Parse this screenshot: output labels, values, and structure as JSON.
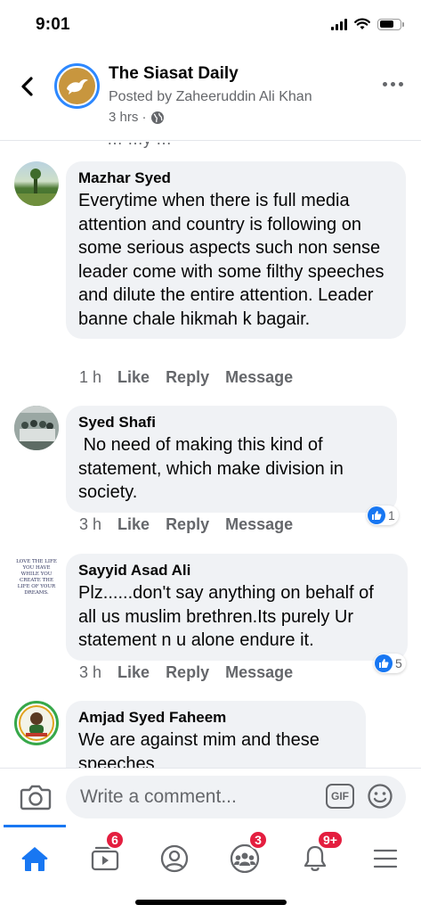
{
  "status_bar": {
    "time": "9:01"
  },
  "header": {
    "title": "The Siasat Daily",
    "posted_by": "Posted by Zaheeruddin Ali Khan",
    "time": "3 hrs ·"
  },
  "cut_text": "… …y …",
  "comments": [
    {
      "name": "Mazhar Syed",
      "text": "Everytime when there is full media attention and country is following on some serious aspects such non sense leader come with some filthy speeches and dilute the entire attention. Leader banne chale hikmah k bagair.",
      "time": "1 h",
      "like": "Like",
      "reply": "Reply",
      "message": "Message"
    },
    {
      "name": "Syed Shafi",
      "text": " No need of making this kind of statement, which make division in society.",
      "time": "3 h",
      "like": "Like",
      "reply": "Reply",
      "message": "Message",
      "reactions": "1"
    },
    {
      "name": "Sayyid Asad Ali",
      "avatar_text": "LOVE THE LIFE YOU HAVE WHILE YOU CREATE THE LIFE OF YOUR DREAMS.",
      "text": "Plz......don't say anything on behalf of all us muslim brethren.Its purely Ur statement n u alone endure it.",
      "time": "3 h",
      "like": "Like",
      "reply": "Reply",
      "message": "Message",
      "reactions": "5"
    },
    {
      "name": "Amjad Syed Faheem",
      "text": "We are against mim and these speeches"
    }
  ],
  "comment_bar": {
    "placeholder": "Write a comment...",
    "gif_label": "GIF"
  },
  "tabs": {
    "watch_badge": "6",
    "groups_badge": "3",
    "notifications_badge": "9+"
  },
  "colors": {
    "accent": "#1877f2",
    "badge": "#e41e3f",
    "bubble": "#f0f2f5",
    "secondary_text": "#65676b"
  },
  "icons": [
    "back-icon",
    "more-icon",
    "globe-icon",
    "like-icon",
    "camera-icon",
    "emoji-icon",
    "home-icon",
    "watch-icon",
    "profile-icon",
    "groups-icon",
    "bell-icon",
    "menu-icon"
  ]
}
